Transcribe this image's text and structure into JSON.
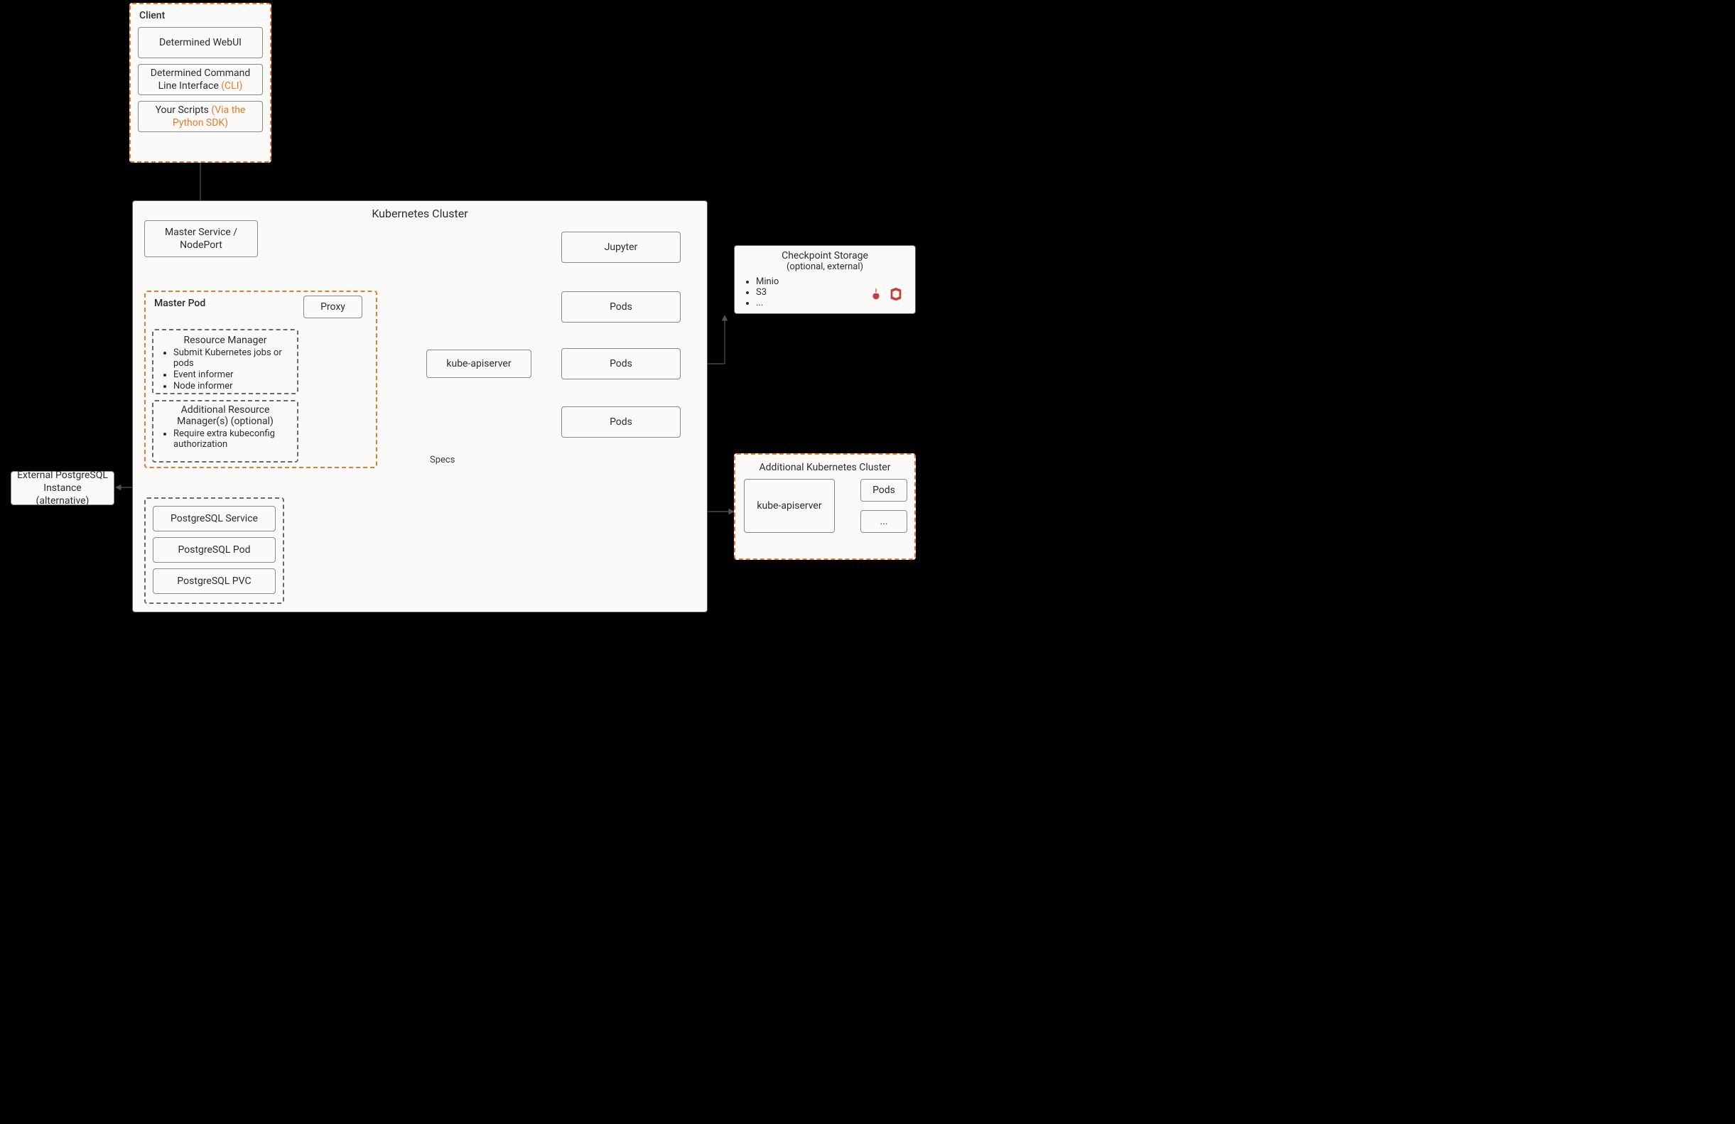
{
  "client": {
    "title": "Client",
    "webui": "Determined WebUI",
    "cli_pre": "Determined Command Line Interface ",
    "cli_link": "(CLI)",
    "scripts_pre": "Your Scripts ",
    "scripts_link": "(Via the Python SDK)"
  },
  "kcluster": {
    "title": "Kubernetes Cluster",
    "master_service": "Master Service / NodePort",
    "master_pod": {
      "title": "Master Pod",
      "proxy": "Proxy",
      "rm": {
        "title": "Resource Manager",
        "items": [
          "Submit Kubernetes jobs or pods",
          "Event informer",
          "Node informer"
        ]
      },
      "arm": {
        "title": "Additional Resource Manager(s) (optional)",
        "items": [
          "Require extra kubeconfig authorization"
        ]
      }
    },
    "kube_apiserver": "kube-apiserver",
    "jupyter": "Jupyter",
    "pods": "Pods",
    "specs_label": "Specs"
  },
  "postgres": {
    "external": "External PostgreSQL Instance (alternative)",
    "service": "PostgreSQL Service",
    "pod": "PostgreSQL Pod",
    "pvc": "PostgreSQL PVC"
  },
  "checkpoint": {
    "title": "Checkpoint Storage",
    "subtitle": "(optional, external)",
    "items": [
      "Minio",
      "S3",
      "..."
    ]
  },
  "addl_cluster": {
    "title": "Additional Kubernetes Cluster",
    "apiserver": "kube-apiserver",
    "pods": "Pods",
    "ellipsis": "..."
  }
}
